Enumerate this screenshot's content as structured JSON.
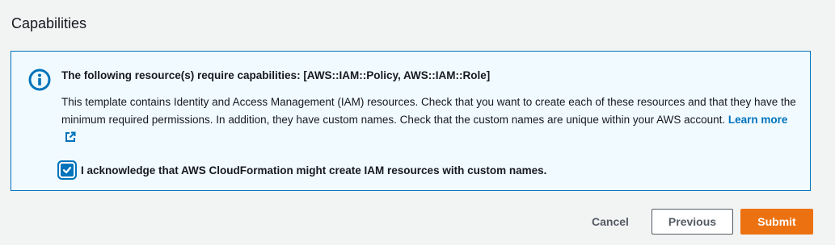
{
  "section": {
    "title": "Capabilities"
  },
  "alert": {
    "type": "info",
    "icon": "info-circle-icon",
    "heading": "The following resource(s) require capabilities: [AWS::IAM::Policy, AWS::IAM::Role]",
    "body": "This template contains Identity and Access Management (IAM) resources. Check that you want to create each of these resources and that they have the minimum required permissions. In addition, they have custom names. Check that the custom names are unique within your AWS account.",
    "learn_more_label": "Learn more",
    "learn_more_icon": "external-link-icon"
  },
  "acknowledge": {
    "checked": true,
    "label": "I acknowledge that AWS CloudFormation might create IAM resources with custom names."
  },
  "actions": {
    "cancel_label": "Cancel",
    "previous_label": "Previous",
    "submit_label": "Submit"
  },
  "colors": {
    "accent_blue": "#0073bb",
    "primary_orange": "#ec7211",
    "info_background": "#f1faff",
    "page_background": "#f2f3f3"
  }
}
